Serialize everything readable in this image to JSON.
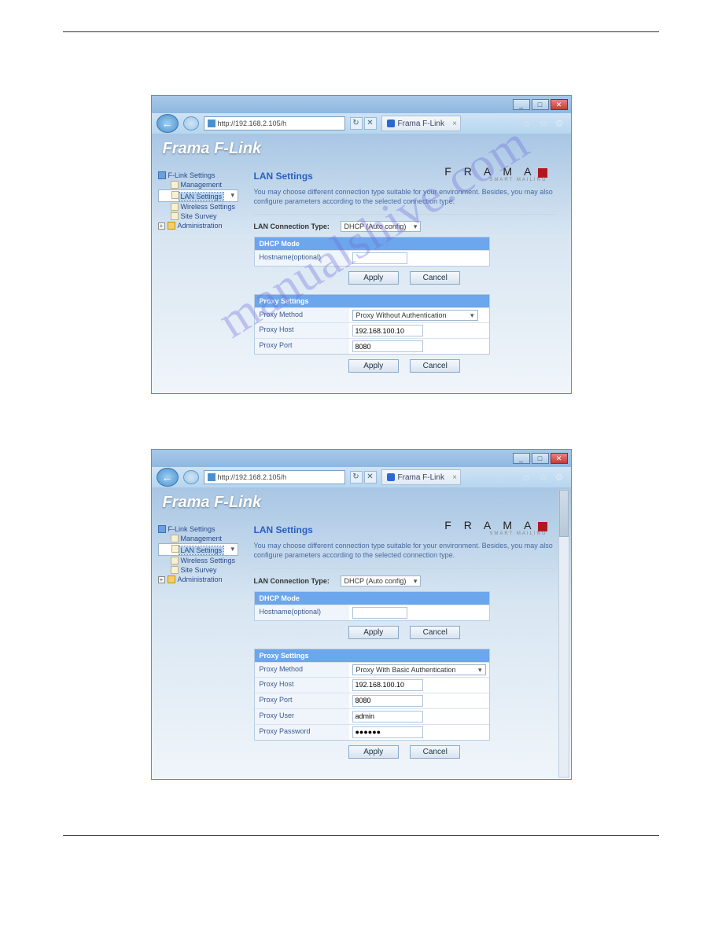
{
  "watermark": "manualshive.com",
  "browser": {
    "url": "http://192.168.2.105/h",
    "tab_title": "Frama F-Link",
    "win_min": "_",
    "win_max": "□",
    "win_close": "✕",
    "back": "←",
    "refresh": "↻",
    "stop": "✕",
    "home_icon": "⌂",
    "star_icon": "☆",
    "gear_icon": "⚙"
  },
  "app": {
    "title": "Frama F-Link",
    "brand": "F R A M A",
    "brand_sub": "SMART MAILING"
  },
  "sidebar": {
    "root": "F-Link Settings",
    "items": [
      "Management",
      "LAN Settings",
      "Wireless Settings",
      "Site Survey"
    ],
    "admin": "Administration",
    "plus": "+"
  },
  "lan": {
    "title": "LAN Settings",
    "desc": "You may choose different connection type suitable for your environment. Besides, you may also configure parameters according to the selected connection type.",
    "conn_type_label": "LAN Connection Type:",
    "conn_type_value": "DHCP (Auto config)",
    "dhcp_header": "DHCP Mode",
    "hostname_label": "Hostname(optional)",
    "apply": "Apply",
    "cancel": "Cancel"
  },
  "proxy1": {
    "header": "Proxy Settings",
    "method_label": "Proxy Method",
    "method_value": "Proxy Without Authentication",
    "host_label": "Proxy Host",
    "host_value": "192.168.100.10",
    "port_label": "Proxy Port",
    "port_value": "8080"
  },
  "proxy2": {
    "header": "Proxy Settings",
    "method_label": "Proxy Method",
    "method_value": "Proxy With Basic Authentication",
    "host_label": "Proxy Host",
    "host_value": "192.168.100.10",
    "port_label": "Proxy Port",
    "port_value": "8080",
    "user_label": "Proxy User",
    "user_value": "admin",
    "pass_label": "Proxy Password",
    "pass_value": "●●●●●●"
  }
}
